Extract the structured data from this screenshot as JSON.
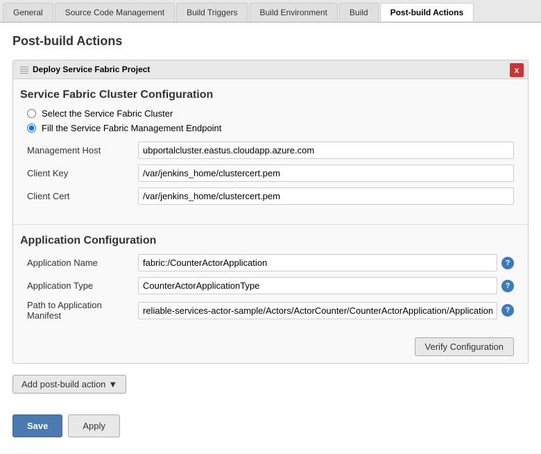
{
  "tabs": [
    {
      "id": "general",
      "label": "General",
      "active": false
    },
    {
      "id": "source-code",
      "label": "Source Code Management",
      "active": false
    },
    {
      "id": "build-triggers",
      "label": "Build Triggers",
      "active": false
    },
    {
      "id": "build-environment",
      "label": "Build Environment",
      "active": false
    },
    {
      "id": "build",
      "label": "Build",
      "active": false
    },
    {
      "id": "post-build-actions",
      "label": "Post-build Actions",
      "active": true
    }
  ],
  "page": {
    "title": "Post-build Actions"
  },
  "action_card": {
    "header": "Deploy Service Fabric Project",
    "close_label": "x",
    "service_fabric_section_title": "Service Fabric Cluster Configuration",
    "radio_option1": "Select the Service Fabric Cluster",
    "radio_option2": "Fill the Service Fabric Management Endpoint",
    "radio_option2_checked": true,
    "fields": {
      "management_host_label": "Management Host",
      "management_host_value": "ubportalcluster.eastus.cloudapp.azure.com",
      "client_key_label": "Client Key",
      "client_key_value": "/var/jenkins_home/clustercert.pem",
      "client_cert_label": "Client Cert",
      "client_cert_value": "/var/jenkins_home/clustercert.pem"
    },
    "app_config_section_title": "Application Configuration",
    "app_fields": {
      "app_name_label": "Application Name",
      "app_name_value": "fabric:/CounterActorApplication",
      "app_type_label": "Application Type",
      "app_type_value": "CounterActorApplicationType",
      "app_manifest_label": "Path to Application Manifest",
      "app_manifest_value": "reliable-services-actor-sample/Actors/ActorCounter/CounterActorApplication/ApplicationManifes"
    },
    "verify_button_label": "Verify Configuration"
  },
  "add_action_button": "Add post-build action",
  "bottom_buttons": {
    "save_label": "Save",
    "apply_label": "Apply"
  }
}
